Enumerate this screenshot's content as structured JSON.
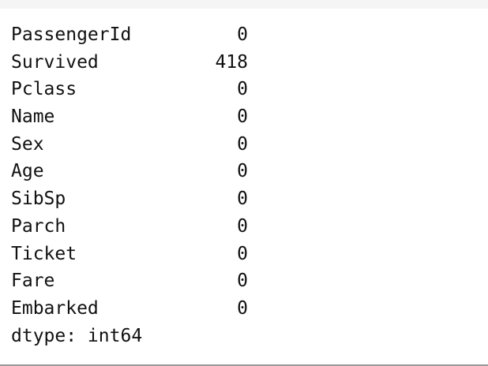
{
  "output": {
    "rows": [
      {
        "label": "PassengerId",
        "value": "0"
      },
      {
        "label": "Survived",
        "value": "418"
      },
      {
        "label": "Pclass",
        "value": "0"
      },
      {
        "label": "Name",
        "value": "0"
      },
      {
        "label": "Sex",
        "value": "0"
      },
      {
        "label": "Age",
        "value": "0"
      },
      {
        "label": "SibSp",
        "value": "0"
      },
      {
        "label": "Parch",
        "value": "0"
      },
      {
        "label": "Ticket",
        "value": "0"
      },
      {
        "label": "Fare",
        "value": "0"
      },
      {
        "label": "Embarked",
        "value": "0"
      }
    ],
    "dtype_line": "dtype: int64"
  }
}
